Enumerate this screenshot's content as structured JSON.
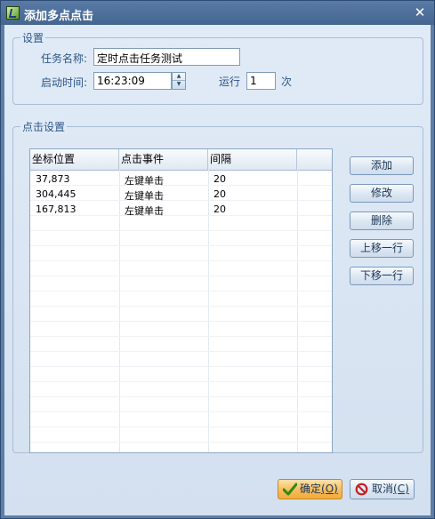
{
  "window": {
    "title": "添加多点点击",
    "close_glyph": "✕"
  },
  "settings": {
    "group_title": "设置",
    "task_name_label": "任务名称:",
    "task_name_value": "定时点击任务测试",
    "start_time_label": "启动时间:",
    "start_time_value": "16:23:09",
    "run_label": "运行",
    "run_count": "1",
    "run_suffix": "次"
  },
  "click_settings": {
    "group_title": "点击设置",
    "columns": [
      "坐标位置",
      "点击事件",
      "间隔"
    ],
    "rows": [
      {
        "position": "37,873",
        "event": "左键单击",
        "interval": "20"
      },
      {
        "position": "304,445",
        "event": "左键单击",
        "interval": "20"
      },
      {
        "position": "167,813",
        "event": "左键单击",
        "interval": "20"
      }
    ]
  },
  "side_buttons": {
    "add": "添加",
    "modify": "修改",
    "delete": "删除",
    "move_up": "上移一行",
    "move_down": "下移一行"
  },
  "footer": {
    "ok_label": "确定",
    "ok_hotkey": "(O)",
    "cancel_label": "取消",
    "cancel_hotkey": "(C)"
  },
  "icons": {
    "app": "app-icon",
    "close": "close-icon",
    "ok": "checkmark-icon",
    "cancel": "prohibited-icon"
  },
  "colors": {
    "title_bar": "#4f729c",
    "client_bg": "#dde8f5",
    "group_text": "#2d5788",
    "ok_button": "#f5b54a"
  }
}
